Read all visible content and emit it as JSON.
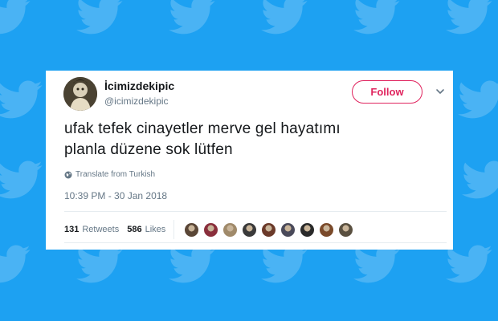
{
  "tweet": {
    "display_name": "İcimizdekipic",
    "handle": "@icimizdekipic",
    "text_lines": [
      "ufak tefek cinayetler merve gel hayatımı",
      "planla düzene sok lütfen"
    ],
    "translate_label": "Translate from Turkish",
    "timestamp": "10:39 PM - 30 Jan 2018",
    "follow_label": "Follow",
    "retweet_count": "131",
    "retweet_label": "Retweets",
    "like_count": "586",
    "like_label": "Likes",
    "liker_avatar_colors": [
      "#5a4636",
      "#8a2f3c",
      "#a08a6a",
      "#3a3a3a",
      "#6b3a2a",
      "#4a4a5a",
      "#2a2a2a",
      "#7a4a2a",
      "#5a5040"
    ]
  },
  "colors": {
    "background": "#1da1f2",
    "follow_accent": "#e0245e",
    "secondary_text": "#657786",
    "primary_text": "#14171a"
  },
  "icons": {
    "background_pattern": "twitter-bird-icon",
    "globe": "globe-icon",
    "menu": "chevron-down-icon"
  }
}
